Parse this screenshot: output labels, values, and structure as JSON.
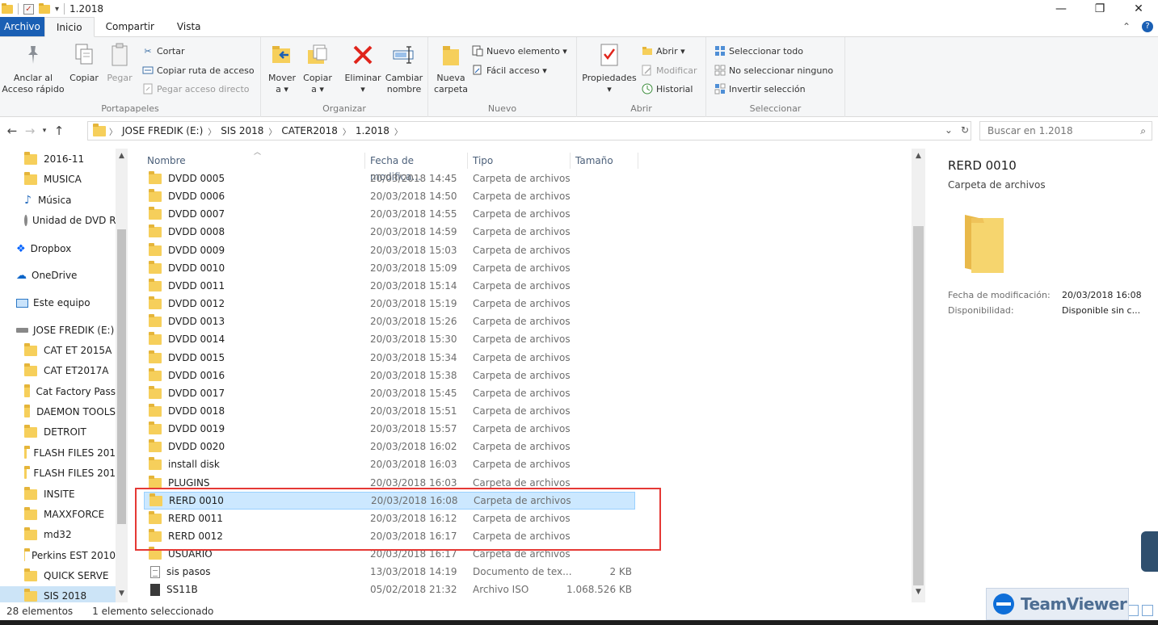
{
  "window": {
    "title": "1.2018",
    "controls": [
      "—",
      "❐",
      "✕"
    ]
  },
  "tabs": [
    {
      "label": "Archivo",
      "kind": "file"
    },
    {
      "label": "Inicio",
      "kind": "active"
    },
    {
      "label": "Compartir",
      "kind": ""
    },
    {
      "label": "Vista",
      "kind": ""
    }
  ],
  "ribbon": {
    "portapapeles": {
      "label": "Portapapeles",
      "pin_line1": "Anclar al",
      "pin_line2": "Acceso rápido",
      "copy": "Copiar",
      "paste": "Pegar",
      "cut": "Cortar",
      "copy_path": "Copiar ruta de acceso",
      "paste_shortcut": "Pegar acceso directo"
    },
    "organizar": {
      "label": "Organizar",
      "move_line1": "Mover",
      "move_line2": "a ▾",
      "copyto_line1": "Copiar",
      "copyto_line2": "a ▾",
      "delete_line1": "Eliminar",
      "delete_line2": "▾",
      "rename_line1": "Cambiar",
      "rename_line2": "nombre"
    },
    "nuevo": {
      "label": "Nuevo",
      "newfolder_line1": "Nueva",
      "newfolder_line2": "carpeta",
      "new_item": "Nuevo elemento ▾",
      "easy_access": "Fácil acceso ▾"
    },
    "abrir": {
      "label": "Abrir",
      "props_line1": "Propiedades",
      "props_line2": "▾",
      "open": "Abrir ▾",
      "edit": "Modificar",
      "history": "Historial"
    },
    "seleccionar": {
      "label": "Seleccionar",
      "select_all": "Seleccionar todo",
      "select_none": "No seleccionar ninguno",
      "invert": "Invertir selección"
    }
  },
  "address": {
    "crumbs": [
      "JOSE FREDIK (E:)",
      "SIS 2018",
      "CATER2018",
      "1.2018"
    ],
    "search_placeholder": "Buscar en 1.2018"
  },
  "nav": [
    {
      "label": "2016-11",
      "icon": "folder",
      "indent": 30
    },
    {
      "label": "MUSICA",
      "icon": "folder",
      "indent": 30
    },
    {
      "label": "Música",
      "icon": "music",
      "indent": 30
    },
    {
      "label": "Unidad de DVD R",
      "icon": "dvd",
      "indent": 30
    },
    {
      "label": "Dropbox",
      "icon": "dropbox",
      "indent": 20
    },
    {
      "label": "OneDrive",
      "icon": "onedrive",
      "indent": 20
    },
    {
      "label": "Este equipo",
      "icon": "pc",
      "indent": 20
    },
    {
      "label": "JOSE FREDIK (E:)",
      "icon": "drive",
      "indent": 20
    },
    {
      "label": "CAT ET 2015A",
      "icon": "folder",
      "indent": 30
    },
    {
      "label": "CAT ET2017A",
      "icon": "folder",
      "indent": 30
    },
    {
      "label": "Cat Factory Pass",
      "icon": "folder",
      "indent": 30
    },
    {
      "label": "DAEMON TOOLS",
      "icon": "folder",
      "indent": 30
    },
    {
      "label": "DETROIT",
      "icon": "folder",
      "indent": 30
    },
    {
      "label": "FLASH FILES 201",
      "icon": "folder",
      "indent": 30
    },
    {
      "label": "FLASH FILES 201",
      "icon": "folder",
      "indent": 30
    },
    {
      "label": "INSITE",
      "icon": "folder",
      "indent": 30
    },
    {
      "label": "MAXXFORCE",
      "icon": "folder",
      "indent": 30
    },
    {
      "label": "md32",
      "icon": "folder",
      "indent": 30
    },
    {
      "label": "Perkins EST 2010",
      "icon": "folder",
      "indent": 30
    },
    {
      "label": "QUICK SERVE",
      "icon": "folder",
      "indent": 30
    },
    {
      "label": "SIS 2018",
      "icon": "folder",
      "indent": 30,
      "selected": true
    }
  ],
  "columns": {
    "name": "Nombre",
    "date": "Fecha de modifica...",
    "type": "Tipo",
    "size": "Tamaño"
  },
  "files": [
    {
      "name": "DVDD 0005",
      "date": "20/03/2018 14:45",
      "type": "Carpeta de archivos",
      "size": "",
      "icon": "folder"
    },
    {
      "name": "DVDD 0006",
      "date": "20/03/2018 14:50",
      "type": "Carpeta de archivos",
      "size": "",
      "icon": "folder"
    },
    {
      "name": "DVDD 0007",
      "date": "20/03/2018 14:55",
      "type": "Carpeta de archivos",
      "size": "",
      "icon": "folder"
    },
    {
      "name": "DVDD 0008",
      "date": "20/03/2018 14:59",
      "type": "Carpeta de archivos",
      "size": "",
      "icon": "folder"
    },
    {
      "name": "DVDD 0009",
      "date": "20/03/2018 15:03",
      "type": "Carpeta de archivos",
      "size": "",
      "icon": "folder"
    },
    {
      "name": "DVDD 0010",
      "date": "20/03/2018 15:09",
      "type": "Carpeta de archivos",
      "size": "",
      "icon": "folder"
    },
    {
      "name": "DVDD 0011",
      "date": "20/03/2018 15:14",
      "type": "Carpeta de archivos",
      "size": "",
      "icon": "folder"
    },
    {
      "name": "DVDD 0012",
      "date": "20/03/2018 15:19",
      "type": "Carpeta de archivos",
      "size": "",
      "icon": "folder"
    },
    {
      "name": "DVDD 0013",
      "date": "20/03/2018 15:26",
      "type": "Carpeta de archivos",
      "size": "",
      "icon": "folder"
    },
    {
      "name": "DVDD 0014",
      "date": "20/03/2018 15:30",
      "type": "Carpeta de archivos",
      "size": "",
      "icon": "folder"
    },
    {
      "name": "DVDD 0015",
      "date": "20/03/2018 15:34",
      "type": "Carpeta de archivos",
      "size": "",
      "icon": "folder"
    },
    {
      "name": "DVDD 0016",
      "date": "20/03/2018 15:38",
      "type": "Carpeta de archivos",
      "size": "",
      "icon": "folder"
    },
    {
      "name": "DVDD 0017",
      "date": "20/03/2018 15:45",
      "type": "Carpeta de archivos",
      "size": "",
      "icon": "folder"
    },
    {
      "name": "DVDD 0018",
      "date": "20/03/2018 15:51",
      "type": "Carpeta de archivos",
      "size": "",
      "icon": "folder"
    },
    {
      "name": "DVDD 0019",
      "date": "20/03/2018 15:57",
      "type": "Carpeta de archivos",
      "size": "",
      "icon": "folder"
    },
    {
      "name": "DVDD 0020",
      "date": "20/03/2018 16:02",
      "type": "Carpeta de archivos",
      "size": "",
      "icon": "folder"
    },
    {
      "name": "install disk",
      "date": "20/03/2018 16:03",
      "type": "Carpeta de archivos",
      "size": "",
      "icon": "folder"
    },
    {
      "name": "PLUGINS",
      "date": "20/03/2018 16:03",
      "type": "Carpeta de archivos",
      "size": "",
      "icon": "folder"
    },
    {
      "name": "RERD 0010",
      "date": "20/03/2018 16:08",
      "type": "Carpeta de archivos",
      "size": "",
      "icon": "folder",
      "selected": true
    },
    {
      "name": "RERD 0011",
      "date": "20/03/2018 16:12",
      "type": "Carpeta de archivos",
      "size": "",
      "icon": "folder"
    },
    {
      "name": "RERD 0012",
      "date": "20/03/2018 16:17",
      "type": "Carpeta de archivos",
      "size": "",
      "icon": "folder"
    },
    {
      "name": "USUARIO",
      "date": "20/03/2018 16:17",
      "type": "Carpeta de archivos",
      "size": "",
      "icon": "folder"
    },
    {
      "name": "sis pasos",
      "date": "13/03/2018 14:19",
      "type": "Documento de tex...",
      "size": "2 KB",
      "icon": "txt"
    },
    {
      "name": "SS11B",
      "date": "05/02/2018 21:32",
      "type": "Archivo ISO",
      "size": "1.068.526 KB",
      "icon": "iso"
    }
  ],
  "details": {
    "title": "RERD 0010",
    "subtitle": "Carpeta de archivos",
    "modified_label": "Fecha de modificación:",
    "modified_value": "20/03/2018 16:08",
    "availability_label": "Disponibilidad:",
    "availability_value": "Disponible sin c..."
  },
  "status": {
    "count": "28 elementos",
    "selected": "1 elemento seleccionado"
  },
  "teamviewer": {
    "label": "TeamViewer"
  },
  "colors": {
    "accent": "#1a5fb4",
    "selection": "#cce8ff",
    "folder": "#f6cf5b",
    "highlight": "#e53935"
  }
}
